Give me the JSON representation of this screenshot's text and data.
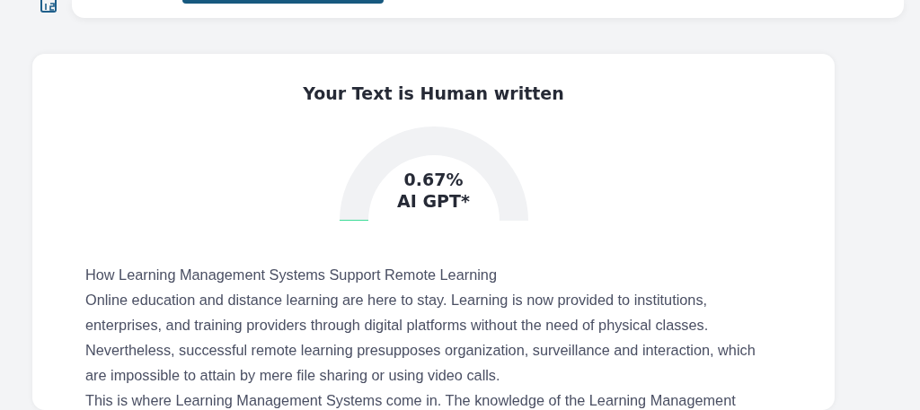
{
  "result": {
    "title": "Your Text is Human written",
    "gauge": {
      "reading": "0.67%",
      "label": "AI GPT*"
    },
    "paragraphs": [
      "How Learning Management Systems Support Remote Learning",
      "Online education and distance learning are here to stay. Learning is now provided to institutions, enterprises, and training providers through digital platforms without the need of physical classes. Nevertheless, successful remote learning presupposes organization, surveillance and interaction, which are impossible to attain by mere file sharing or using video calls.",
      "This is where Learning Management Systems come in. The knowledge of the Learning Management"
    ]
  }
}
